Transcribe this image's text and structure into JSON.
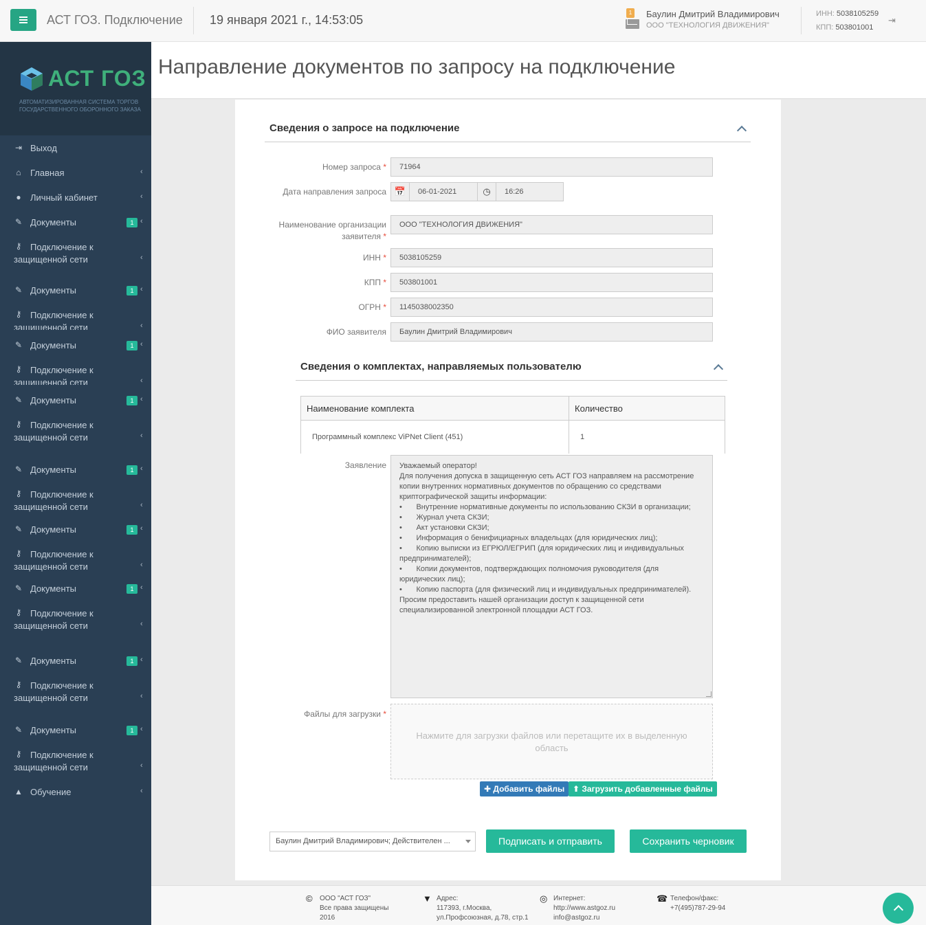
{
  "topbar": {
    "app_title": "АСТ ГОЗ. Подключение",
    "datetime": "19 января 2021 г., 14:53:05",
    "notification_count": "1",
    "user_name": "Баулин Дмитрий Владимирович",
    "user_org": "ООО \"ТЕХНОЛОГИЯ ДВИЖЕНИЯ\"",
    "inn_label": "ИНН:",
    "inn_value": "5038105259",
    "kpp_label": "КПП:",
    "kpp_value": "503801001"
  },
  "logo": {
    "text": "АСТ ГОЗ",
    "subtitle": "Автоматизированная система торгов государственного оборонного заказа"
  },
  "sidebar": {
    "items": [
      {
        "label": "Выход",
        "icon": "sign-out-icon"
      },
      {
        "label": "Главная",
        "icon": "home-icon"
      },
      {
        "label": "Личный кабинет",
        "icon": "user-icon"
      },
      {
        "label": "Документы",
        "icon": "pencil-icon",
        "badge": "1"
      },
      {
        "label": "Подключение к",
        "label2": "защищенной сети",
        "icon": "key-icon"
      },
      {
        "label": "Документы",
        "icon": "pencil-icon",
        "badge": "1"
      },
      {
        "label": "Подключение к",
        "label2": "защищенной сети",
        "icon": "key-icon"
      },
      {
        "label": "Документы",
        "icon": "pencil-icon",
        "badge": "1"
      },
      {
        "label": "Подключение к",
        "label2": "защищенной сети",
        "icon": "key-icon"
      },
      {
        "label": "Документы",
        "icon": "pencil-icon",
        "badge": "1"
      },
      {
        "label": "Подключение к",
        "label2": "защищенной сети",
        "icon": "key-icon"
      },
      {
        "label": "Документы",
        "icon": "pencil-icon",
        "badge": "1"
      },
      {
        "label": "Подключение к",
        "label2": "защищенной сети",
        "icon": "key-icon"
      },
      {
        "label": "Документы",
        "icon": "pencil-icon",
        "badge": "1"
      },
      {
        "label": "Подключение к",
        "label2": "защищенной сети",
        "icon": "key-icon"
      },
      {
        "label": "Документы",
        "icon": "pencil-icon",
        "badge": "1"
      },
      {
        "label": "Подключение к",
        "label2": "защищенной сети",
        "icon": "key-icon"
      },
      {
        "label": "Документы",
        "icon": "pencil-icon",
        "badge": "1"
      },
      {
        "label": "Подключение к",
        "label2": "защищенной сети",
        "icon": "key-icon"
      },
      {
        "label": "Документы",
        "icon": "pencil-icon",
        "badge": "1"
      },
      {
        "label": "Подключение к",
        "label2": "защищенной сети",
        "icon": "key-icon"
      },
      {
        "label": "Обучение",
        "icon": "graduation-cap-icon"
      }
    ]
  },
  "page": {
    "title": "Направление документов по запросу на подключение"
  },
  "request_section": {
    "title": "Сведения о запросе на подключение",
    "fields": {
      "request_number": {
        "label": "Номер запроса",
        "value": "71964"
      },
      "send_date": {
        "label": "Дата направления запроса",
        "date": "06-01-2021",
        "time": "16:26"
      },
      "org_name": {
        "label": "Наименование организации заявителя",
        "value": "ООО \"ТЕХНОЛОГИЯ ДВИЖЕНИЯ\""
      },
      "inn": {
        "label": "ИНН",
        "value": "5038105259"
      },
      "kpp": {
        "label": "КПП",
        "value": "503801001"
      },
      "ogrn": {
        "label": "ОГРН",
        "value": "1145038002350"
      },
      "applicant": {
        "label": "ФИО заявителя",
        "value": "Баулин Дмитрий Владимирович"
      }
    },
    "required_mark": "*"
  },
  "kits_section": {
    "title": "Сведения о комплектах, направляемых пользователю",
    "columns": [
      "Наименование комплекта",
      "Количество"
    ],
    "rows": [
      {
        "name": "Программный комплекс ViPNet Client (451)",
        "qty": "1"
      }
    ]
  },
  "statement": {
    "label": "Заявление",
    "text": "Уважаемый оператор!\nДля получения допуска в защищенную сеть АСТ ГОЗ направляем на рассмотрение копии внутренних нормативных документов по обращению со средствами криптографической защиты информации:\n•\tВнутренние нормативные документы по использованию СКЗИ в организации;\n•\tЖурнал учета СКЗИ;\n•\tАкт установки СКЗИ;\n•\tИнформация о бенифициарных владельцах (для юридических лиц);\n•\tКопию выписки из ЕГРЮЛ/ЕГРИП (для юридических лиц и индивидуальных предпринимателей);\n•\tКопии документов, подтверждающих полномочия руководителя (для юридических лиц);\n•\tКопию паспорта (для физический лиц и индивидуальных предпринимателей).\nПросим предоставить нашей организации доступ к защищенной сети специализированной электронной площадки АСТ ГОЗ."
  },
  "files": {
    "label": "Файлы для загрузки",
    "dropzone_text": "Нажмите для загрузки файлов или перетащите их в выделенную область",
    "add_button": "Добавить файлы",
    "upload_button": "Загрузить добавленные файлы"
  },
  "actions": {
    "certificate": "Баулин Дмитрий Владимирович; Действителен ...",
    "sign_button": "Подписать и отправить",
    "draft_button": "Сохранить черновик"
  },
  "footer": {
    "company": {
      "line1": "ООО \"АСТ ГОЗ\"",
      "line2": "Все права защищены",
      "line3": "2016"
    },
    "address": {
      "line1": "Адрес:",
      "line2": "117393, г.Москва,",
      "line3": "ул.Профсоюзная, д.78, стр.1"
    },
    "internet": {
      "line1": "Интернет:",
      "line2": "http://www.astgoz.ru",
      "line3": "info@astgoz.ru"
    },
    "phone": {
      "line1": "Телефон/факс:",
      "line2": "+7(495)787-29-94"
    }
  },
  "colors": {
    "accent": "#26b99a",
    "sidebar": "#2a3f54",
    "link_blue": "#337ab7"
  }
}
